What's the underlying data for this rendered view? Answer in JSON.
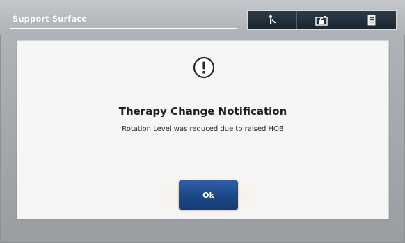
{
  "header": {
    "title": "Support Surface",
    "toolbar": [
      {
        "icon": "patient-figure-icon"
      },
      {
        "icon": "unlock-icon"
      },
      {
        "icon": "document-icon"
      }
    ]
  },
  "dialog": {
    "icon": "exclamation-circle-icon",
    "title": "Therapy Change Notification",
    "message": "Rotation Level was reduced due to raised HOB",
    "ok_label": "Ok"
  },
  "colors": {
    "accent": "#1b4786",
    "toolbar_bg": "#22303e",
    "dialog_bg": "#f6f6f6",
    "frame_bg": "#a8acb0"
  }
}
